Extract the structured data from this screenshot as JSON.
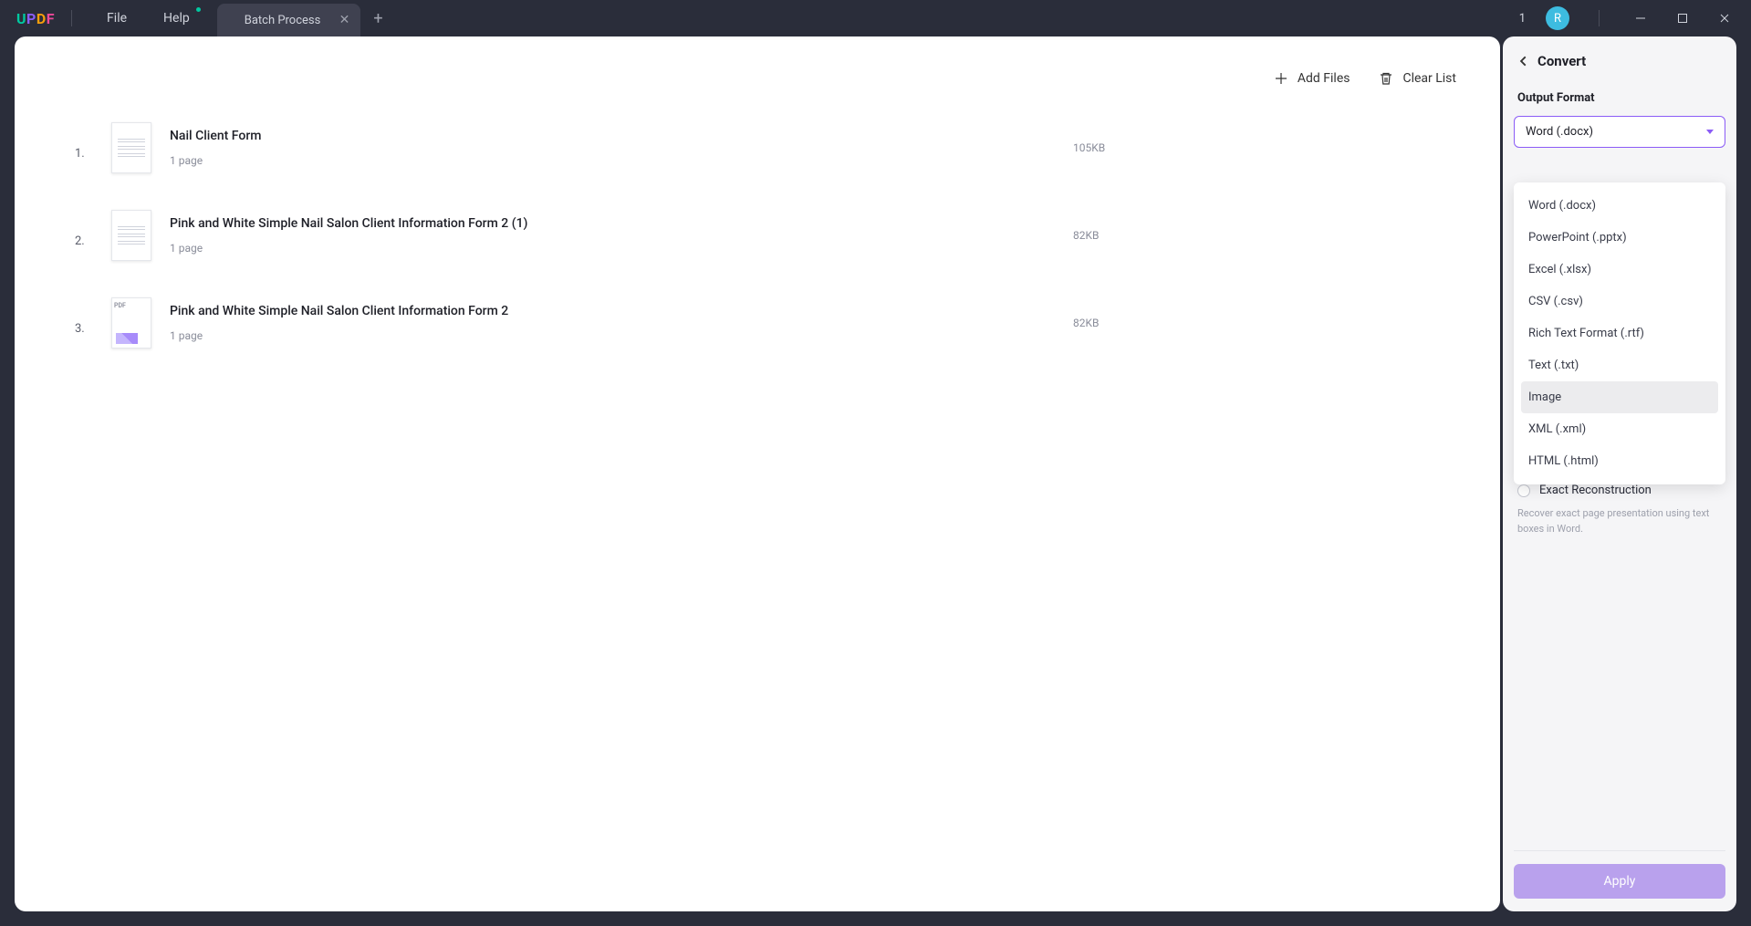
{
  "titlebar": {
    "menu_file": "File",
    "menu_help": "Help",
    "tab_title": "Batch Process",
    "page_num": "1",
    "avatar_initial": "R"
  },
  "toolbar": {
    "add_files": "Add Files",
    "clear_list": "Clear List"
  },
  "files": [
    {
      "index": "1.",
      "name": "Nail Client Form",
      "pages": "1 page",
      "size": "105KB"
    },
    {
      "index": "2.",
      "name": "Pink and White Simple Nail Salon Client Information Form 2 (1)",
      "pages": "1 page",
      "size": "82KB"
    },
    {
      "index": "3.",
      "name": "Pink and White Simple Nail Salon Client Information Form 2",
      "pages": "1 page",
      "size": "82KB"
    }
  ],
  "side": {
    "title": "Convert",
    "format_label": "Output Format",
    "format_selected": "Word (.docx)",
    "options": [
      "Word (.docx)",
      "PowerPoint (.pptx)",
      "Excel (.xlsx)",
      "CSV (.csv)",
      "Rich Text Format (.rtf)",
      "Text (.txt)",
      "Image",
      "XML (.xml)",
      "HTML (.html)"
    ],
    "highlighted_option_index": 6,
    "radio_label": "Exact Reconstruction",
    "help_text": "Recover exact page presentation using text boxes in Word.",
    "apply": "Apply"
  }
}
